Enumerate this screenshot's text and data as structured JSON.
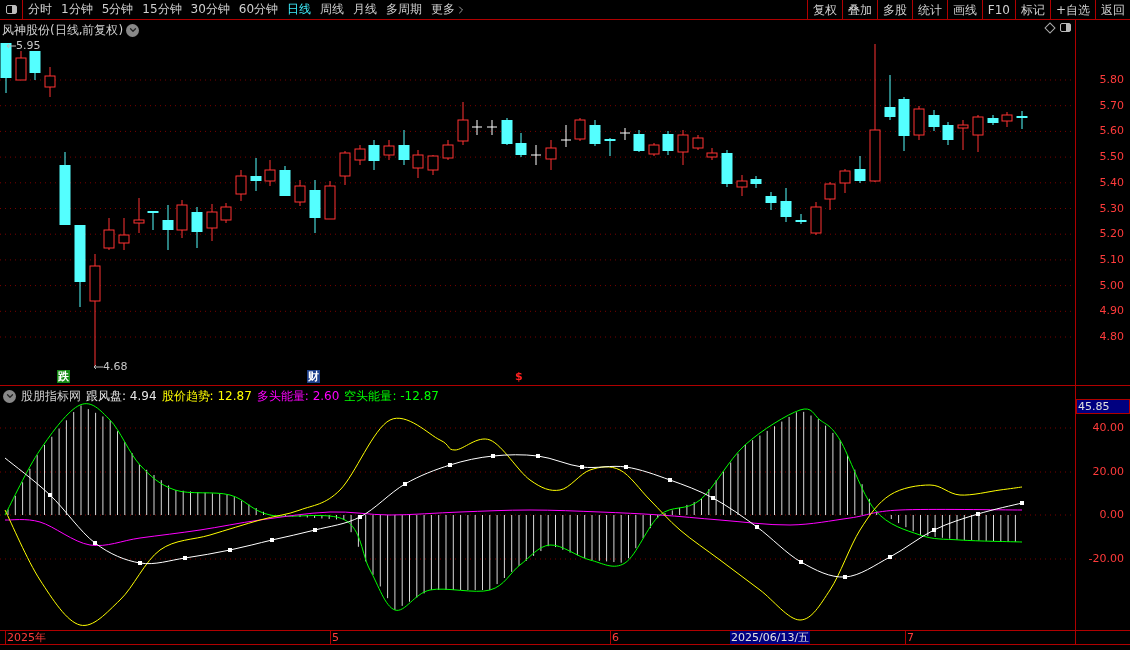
{
  "toolbar": {
    "periods": [
      {
        "label": "分时",
        "selected": false
      },
      {
        "label": "1分钟",
        "selected": false
      },
      {
        "label": "5分钟",
        "selected": false
      },
      {
        "label": "15分钟",
        "selected": false
      },
      {
        "label": "30分钟",
        "selected": false
      },
      {
        "label": "60分钟",
        "selected": false
      },
      {
        "label": "日线",
        "selected": true
      },
      {
        "label": "周线",
        "selected": false
      },
      {
        "label": "月线",
        "selected": false
      },
      {
        "label": "多周期",
        "selected": false
      }
    ],
    "more": "更多",
    "actions": [
      "复权",
      "叠加",
      "多股",
      "统计",
      "画线",
      "F10",
      "标记",
      "+自选",
      "返回"
    ]
  },
  "main_chart": {
    "title": "风神股份(日线,前复权)",
    "high_label": "5.95",
    "low_label": "4.68",
    "markers": [
      {
        "text": "跌",
        "kind": "fall"
      },
      {
        "text": "财",
        "kind": "finance"
      },
      {
        "text": "$",
        "kind": "dollar"
      }
    ],
    "price_axis": [
      "5.80",
      "5.70",
      "5.60",
      "5.50",
      "5.40",
      "5.30",
      "5.20",
      "5.10",
      "5.00",
      "4.90",
      "4.80"
    ]
  },
  "indicator": {
    "name": "股朋指标网",
    "values": [
      {
        "text": "跟风盘: 4.94",
        "color": "#e6e6e6"
      },
      {
        "text": "股价趋势: 12.87",
        "color": "#ffff00"
      },
      {
        "text": "多头能量: 2.60",
        "color": "#ff00ff"
      },
      {
        "text": "空头能量: -12.87",
        "color": "#00ff00"
      }
    ],
    "axis_current": "45.85",
    "axis": [
      "40.00",
      "20.00",
      "0.00",
      "-20.00"
    ]
  },
  "date_axis": [
    {
      "text": "2025年",
      "highlighted": false
    },
    {
      "text": "5",
      "highlighted": false
    },
    {
      "text": "6",
      "highlighted": false
    },
    {
      "text": "2025/06/13/五",
      "highlighted": true
    },
    {
      "text": "7",
      "highlighted": false
    }
  ]
}
